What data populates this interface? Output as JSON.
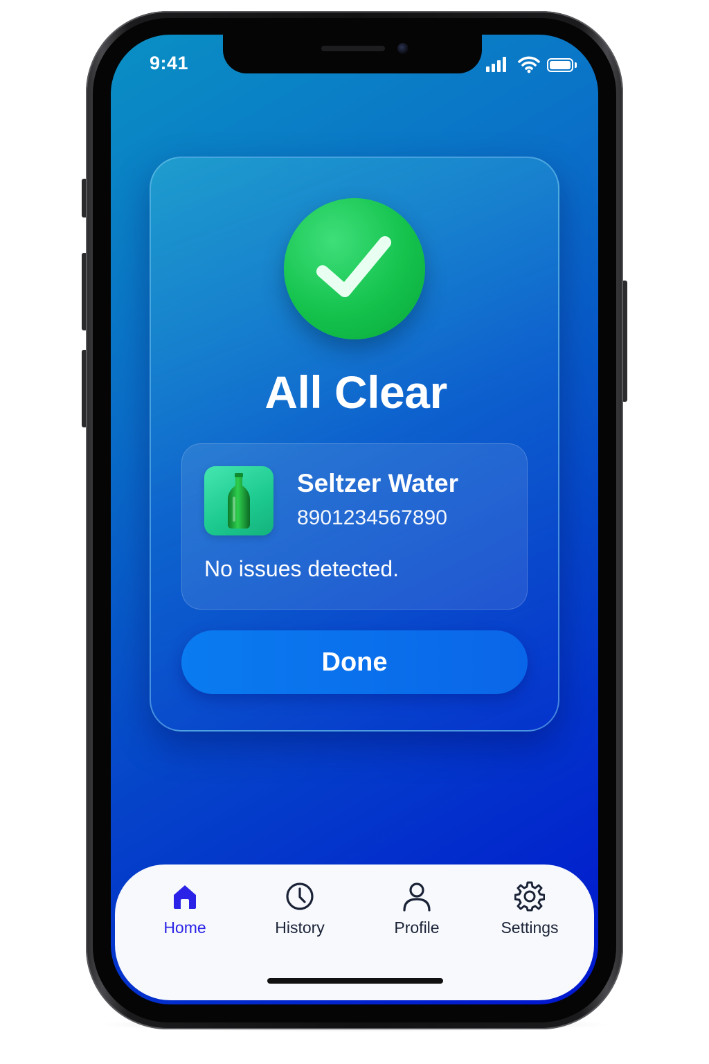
{
  "status_bar": {
    "time": "9:41"
  },
  "result": {
    "title": "All Clear",
    "status_icon": "checkmark-icon",
    "accent_color": "#14c24c"
  },
  "product": {
    "name": "Seltzer Water",
    "barcode": "8901234567890",
    "note": "No issues detected.",
    "thumbnail_icon": "bottle-icon"
  },
  "actions": {
    "done_label": "Done"
  },
  "tab_bar": {
    "active_color": "#2a22e6",
    "items": [
      {
        "label": "Home",
        "icon": "home-icon",
        "active": true
      },
      {
        "label": "History",
        "icon": "clock-icon",
        "active": false
      },
      {
        "label": "Profile",
        "icon": "person-icon",
        "active": false
      },
      {
        "label": "Settings",
        "icon": "gear-icon",
        "active": false
      }
    ]
  }
}
